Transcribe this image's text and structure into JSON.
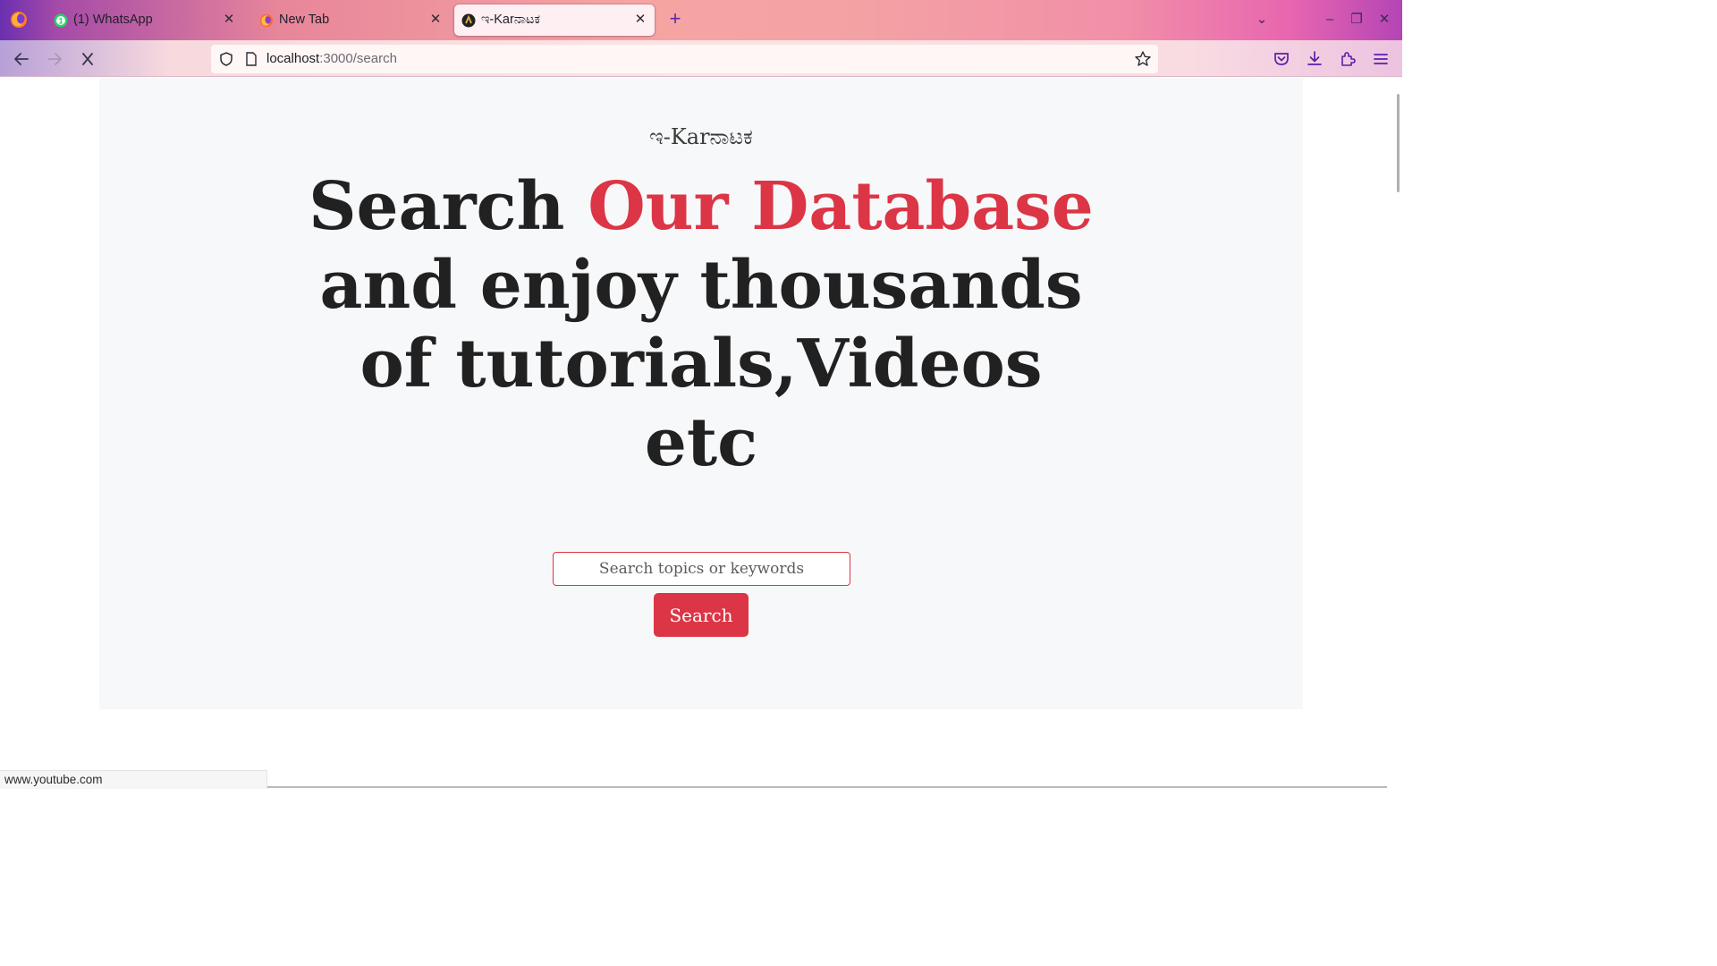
{
  "browser": {
    "tabs": [
      {
        "title": "(1) WhatsApp",
        "favicon": "whatsapp-icon",
        "active": false
      },
      {
        "title": "New Tab",
        "favicon": "firefox-icon",
        "active": false
      },
      {
        "title": "ಇ-Karನಾಟಕ",
        "favicon": "site-favicon",
        "active": true
      }
    ],
    "url_host": "localhost",
    "url_path": ":3000/search",
    "status_text": "www.youtube.com"
  },
  "page": {
    "brand": "ಇ-Karನಾಟಕ",
    "headline_part1": "Search ",
    "headline_accent": "Our Database",
    "headline_part2": " and enjoy thousands of tutorials,Videos etc",
    "search_placeholder": "Search topics or keywords",
    "search_button": "Search"
  },
  "colors": {
    "accent": "#dc3545",
    "headline": "#212121",
    "page_background": "#f7f8fa"
  }
}
